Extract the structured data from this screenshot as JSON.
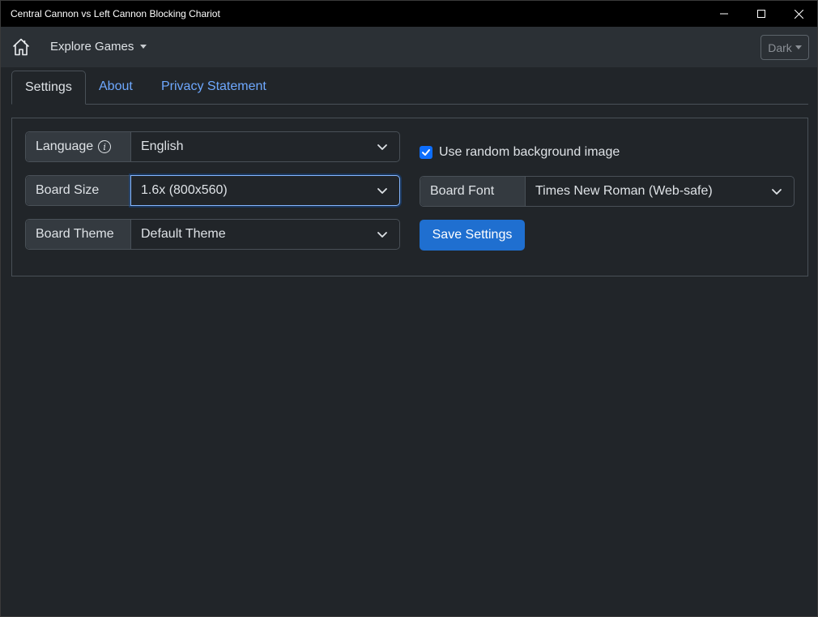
{
  "window": {
    "title": "Central Cannon vs Left Cannon Blocking Chariot"
  },
  "navbar": {
    "home_icon": "home-icon",
    "explore_label": "Explore Games",
    "theme_label": "Dark"
  },
  "tabs": [
    {
      "label": "Settings",
      "active": true
    },
    {
      "label": "About",
      "active": false
    },
    {
      "label": "Privacy Statement",
      "active": false
    }
  ],
  "settings": {
    "language": {
      "label": "Language",
      "value": "English"
    },
    "board_size": {
      "label": "Board Size",
      "value": "1.6x (800x560)"
    },
    "board_theme": {
      "label": "Board Theme",
      "value": "Default Theme"
    },
    "random_bg": {
      "label": "Use random background image",
      "checked": true
    },
    "board_font": {
      "label": "Board Font",
      "value": "Times New Roman (Web-safe)"
    },
    "save_label": "Save Settings"
  },
  "colors": {
    "accent": "#0d6efd",
    "link": "#6ea8fe",
    "background": "#212529"
  }
}
